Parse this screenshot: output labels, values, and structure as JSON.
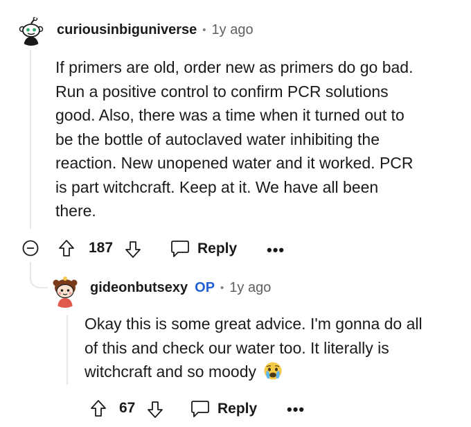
{
  "comment": {
    "username": "curiousinbiguniverse",
    "separator": "•",
    "time": "1y ago",
    "body_lines": [
      "If primers are old, order new as primers do go bad.",
      "Run a positive control to confirm PCR solutions",
      "good. Also, there was a time when it turned out to",
      "be the bottle of autoclaved water inhibiting the",
      "reaction. New unopened water and it worked. PCR",
      "is part witchcraft. Keep at it. We have all been",
      "there."
    ],
    "votes": "187",
    "reply_label": "Reply",
    "more_label": "•••",
    "icons": [
      "collapse-icon",
      "upvote-icon",
      "downvote-icon",
      "reply-icon"
    ]
  },
  "reply": {
    "username": "gideonbutsexy",
    "op_badge": "OP",
    "separator": "•",
    "time": "1y ago",
    "body_lines": [
      "Okay this is some great advice. I'm gonna do all",
      "of this and check our water too. It literally is",
      "witchcraft and so moody"
    ],
    "emoji": "crying-face-emoji",
    "votes": "67",
    "reply_label": "Reply",
    "more_label": "•••"
  },
  "colors": {
    "text": "#1a1a1b",
    "muted": "#5f5f5f",
    "op": "#2461d6",
    "thread_line": "#e5e7ea"
  }
}
